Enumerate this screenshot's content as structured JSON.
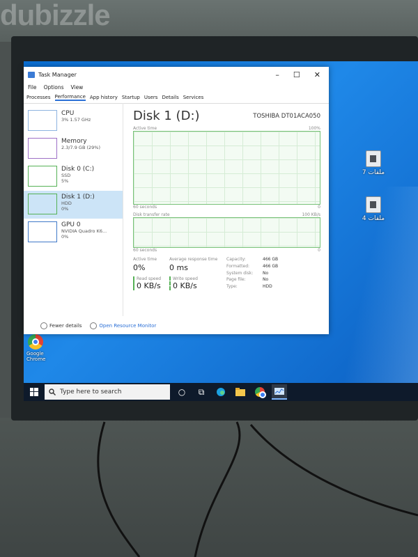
{
  "watermark": "dubizzle",
  "window": {
    "title": "Task Manager",
    "controls": [
      "–",
      "☐",
      "✕"
    ]
  },
  "menu": [
    "File",
    "Options",
    "View"
  ],
  "tabs": [
    "Processes",
    "Performance",
    "App history",
    "Startup",
    "Users",
    "Details",
    "Services"
  ],
  "selected_tab": "Performance",
  "sidebar": [
    {
      "name": "CPU",
      "line1": "3%  1.57 GHz",
      "line2": ""
    },
    {
      "name": "Memory",
      "line1": "2.3/7.9 GB (29%)",
      "line2": ""
    },
    {
      "name": "Disk 0 (C:)",
      "line1": "SSD",
      "line2": "5%"
    },
    {
      "name": "Disk 1 (D:)",
      "line1": "HDD",
      "line2": "0%"
    },
    {
      "name": "GPU 0",
      "line1": "NVIDIA Quadro K6...",
      "line2": "0%"
    }
  ],
  "main": {
    "heading": "Disk 1 (D:)",
    "model": "TOSHIBA DT01ACA050",
    "active_time_label": "Active time",
    "active_max": "100%",
    "sixty": "60 seconds",
    "zero": "0",
    "transfer_label": "Disk transfer rate",
    "transfer_max": "100 KB/s",
    "active_time_key": "Active time",
    "active_time_val": "0%",
    "resp_key": "Average response time",
    "resp_val": "0 ms",
    "read_key": "Read speed",
    "read_val": "0 KB/s",
    "write_key": "Write speed",
    "write_val": "0 KB/s",
    "props": [
      {
        "k": "Capacity:",
        "v": "466 GB"
      },
      {
        "k": "Formatted:",
        "v": "466 GB"
      },
      {
        "k": "System disk:",
        "v": "No"
      },
      {
        "k": "Page file:",
        "v": "No"
      },
      {
        "k": "Type:",
        "v": "HDD"
      }
    ]
  },
  "footer": {
    "fewer": "Fewer details",
    "monitor": "Open Resource Monitor"
  },
  "desktop_icons": [
    "ملفات 7",
    "ملفات 4"
  ],
  "chrome_label": "Google Chrome",
  "taskbar": {
    "search_placeholder": "Type here to search"
  }
}
